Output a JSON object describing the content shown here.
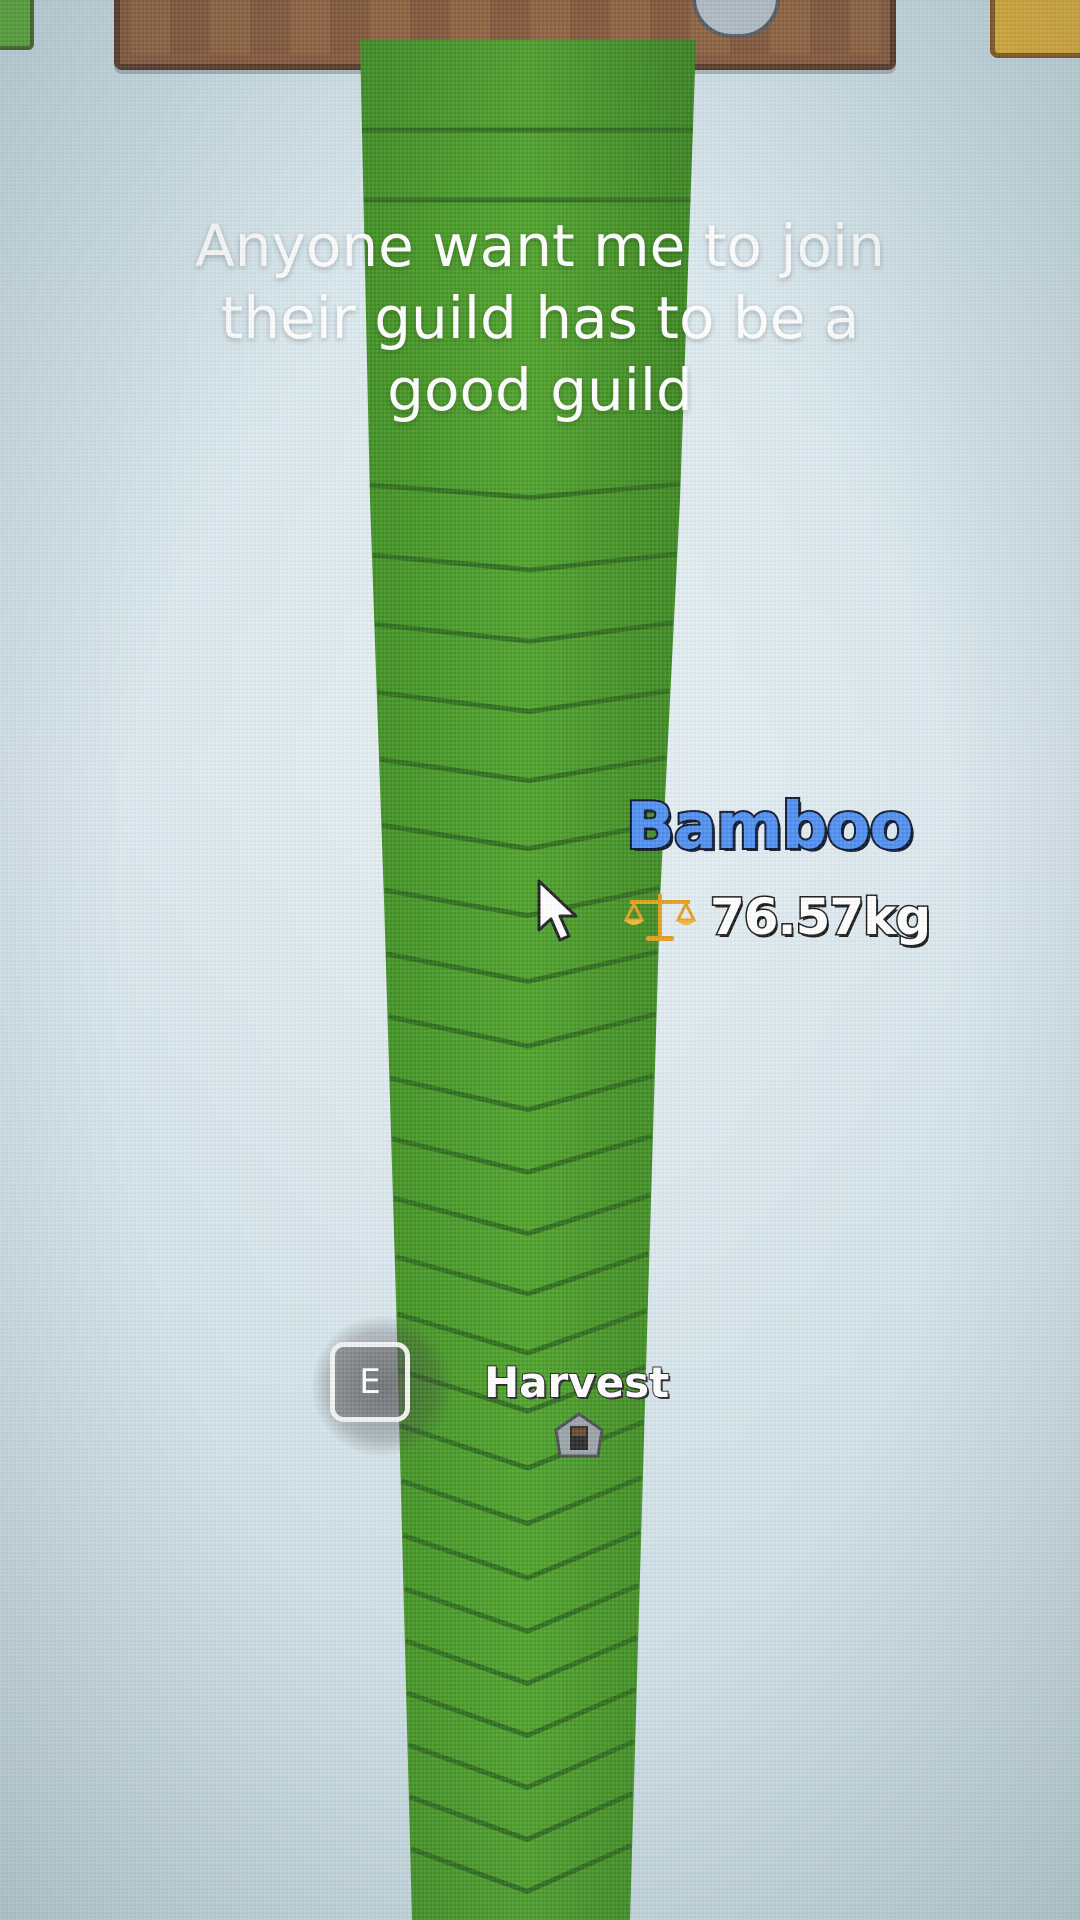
{
  "caption": {
    "text": "Anyone want me to join\ntheir guild has to be a\ngood guild"
  },
  "item": {
    "name": "Bamboo",
    "weight": "76.57kg",
    "weight_icon": "scale-icon",
    "name_color": "#4f8ff0"
  },
  "prompt": {
    "key": "E",
    "action": "Harvest"
  },
  "hud": {
    "top_sign_icon": "tool-icon"
  },
  "colors": {
    "stalk": "#4ea12b",
    "stalk_dark": "#2f6e1d",
    "sky": "#d6e6ec",
    "sign_wood": "#8a5a3c"
  }
}
